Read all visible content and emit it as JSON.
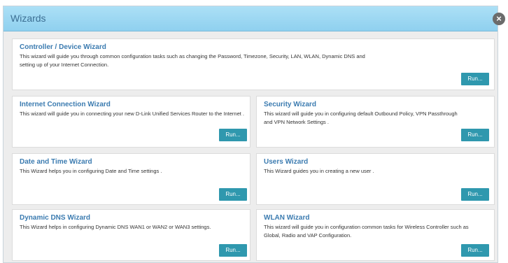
{
  "dialog": {
    "title": "Wizards",
    "close_glyph": "×"
  },
  "wizards": [
    {
      "title": "Controller / Device Wizard",
      "description": "This wizard will guide you through common configuration tasks such as changing the Password, Timezone, Security, LAN, WLAN, Dynamic DNS and setting up of your Internet Connection.",
      "run_label": "Run..."
    },
    {
      "title": "Internet Connection Wizard",
      "description": "This wizard will guide you in connecting your new D-Link Unified Services Router to the Internet .",
      "run_label": "Run..."
    },
    {
      "title": "Security Wizard",
      "description": "This wizard will guide you in configuring default Outbound Policy, VPN Passthrough and VPN Network Settings .",
      "run_label": "Run..."
    },
    {
      "title": "Date and Time Wizard",
      "description": "This Wizard helps you in configuring Date and Time settings .",
      "run_label": "Run..."
    },
    {
      "title": "Users Wizard",
      "description": "This Wizard guides you in creating a new user .",
      "run_label": "Run..."
    },
    {
      "title": "Dynamic DNS Wizard",
      "description": "This Wizard helps in configuring Dynamic DNS WAN1 or WAN2 or WAN3 settings.",
      "run_label": "Run..."
    },
    {
      "title": "WLAN Wizard",
      "description": "This wizard will guide you in configuration common tasks for Wireless Controller such as Global, Radio and VAP Configuration.",
      "run_label": "Run..."
    }
  ]
}
